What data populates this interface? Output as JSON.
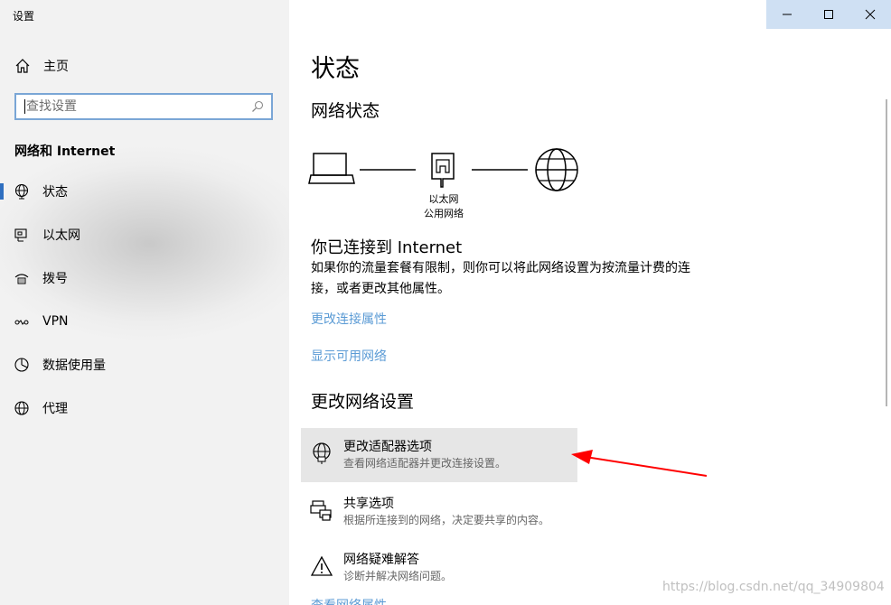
{
  "window": {
    "title": "设置"
  },
  "sidebar": {
    "home_label": "主页",
    "search_placeholder": "查找设置",
    "section_title": "网络和 Internet",
    "items": [
      {
        "label": "状态",
        "icon": "globe-icon",
        "active": true
      },
      {
        "label": "以太网",
        "icon": "ethernet-icon",
        "active": false
      },
      {
        "label": "拨号",
        "icon": "dialup-icon",
        "active": false
      },
      {
        "label": "VPN",
        "icon": "vpn-icon",
        "active": false
      },
      {
        "label": "数据使用量",
        "icon": "data-usage-icon",
        "active": false
      },
      {
        "label": "代理",
        "icon": "globe-icon",
        "active": false
      }
    ]
  },
  "main": {
    "title": "状态",
    "network_status_heading": "网络状态",
    "diagram": {
      "adapter_name": "以太网",
      "network_type": "公用网络"
    },
    "connected_title": "你已连接到 Internet",
    "connected_desc": "如果你的流量套餐有限制，则你可以将此网络设置为按流量计费的连接，或者更改其他属性。",
    "link_change_properties": "更改连接属性",
    "link_show_networks": "显示可用网络",
    "change_settings_heading": "更改网络设置",
    "options": [
      {
        "title": "更改适配器选项",
        "desc": "查看网络适配器并更改连接设置。",
        "icon": "adapter-globe-icon"
      },
      {
        "title": "共享选项",
        "desc": "根据所连接到的网络，决定要共享的内容。",
        "icon": "sharing-printer-icon"
      },
      {
        "title": "网络疑难解答",
        "desc": "诊断并解决网络问题。",
        "icon": "warning-icon"
      }
    ],
    "next_link_partial": "查看网络属性"
  },
  "watermark": "https://blog.csdn.net/qq_34909804",
  "colors": {
    "link": "#5b9bd5",
    "accent": "#2f6fc0",
    "arrow": "#ff0000",
    "highlight": "#e6e6e6"
  }
}
